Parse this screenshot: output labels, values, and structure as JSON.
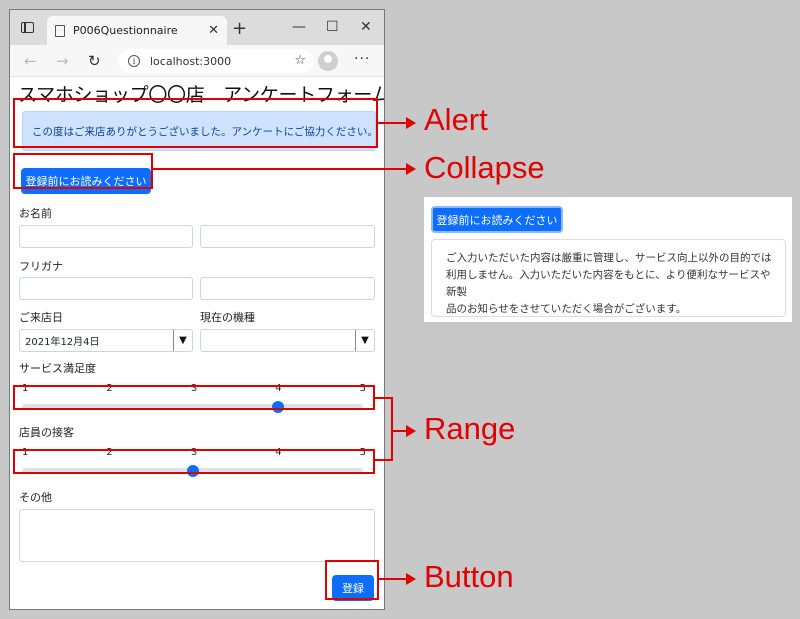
{
  "browser": {
    "tab_title": "P006Questionnaire",
    "tab_close": "✕",
    "new_tab": "+",
    "minimize": "—",
    "maximize": "☐",
    "close": "✕",
    "back": "←",
    "forward": "→",
    "reload": "↻",
    "info": "i",
    "url": "localhost:3000",
    "favorite": "☆",
    "more": "···"
  },
  "page": {
    "title": "スマホショップ〇〇店　アンケートフォーム",
    "alert_text": "この度はご来店ありがとうございました。アンケートにご協力ください。",
    "collapse_button": "登録前にお読みください",
    "name_label": "お名前",
    "furigana_label": "フリガナ",
    "visit_date_label": "ご来店日",
    "visit_date_value": "2021年12月4日",
    "model_label": "現在の機種",
    "model_value": "",
    "select_arrow": "▼",
    "satisfaction_label": "サービス満足度",
    "satisfaction_ticks": [
      "1",
      "2",
      "3",
      "4",
      "5"
    ],
    "satisfaction_value": 4,
    "staff_label": "店員の接客",
    "staff_ticks": [
      "1",
      "2",
      "3",
      "4",
      "5"
    ],
    "staff_value": 3,
    "other_label": "その他",
    "submit_button": "登録"
  },
  "annotations": {
    "alert": "Alert",
    "collapse": "Collapse",
    "range": "Range",
    "button": "Button",
    "color": "#e00000"
  },
  "preview": {
    "button": "登録前にお読みください",
    "text_line1": "ご入力いただいた内容は厳重に管理し、サービス向上以外の目的では",
    "text_line2": "利用しません。入力いただいた内容をもとに、より便利なサービスや新製",
    "text_line3": "品のお知らせをさせていただく場合がございます。"
  },
  "colors": {
    "primary": "#0d6efd",
    "alert_bg": "#cfe2ff",
    "alert_text": "#084298"
  }
}
